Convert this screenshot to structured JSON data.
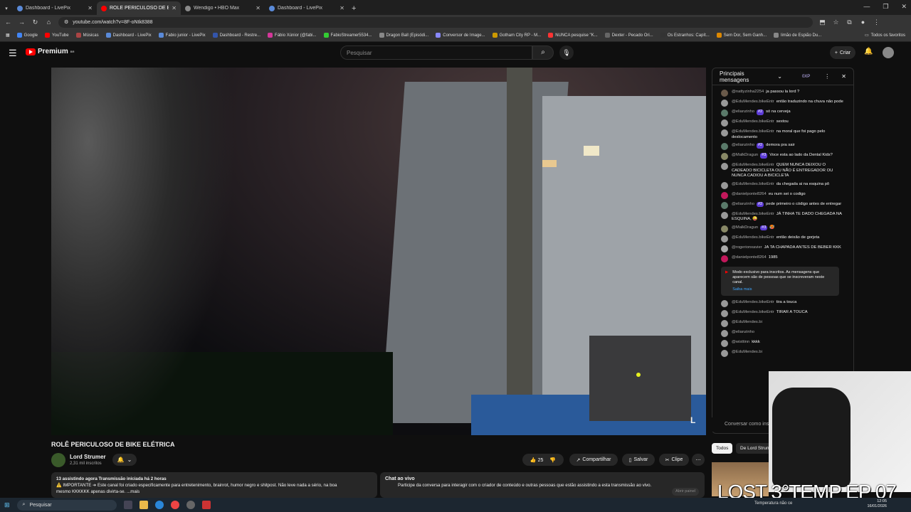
{
  "browser": {
    "tabs": [
      {
        "title": "Dashboard - LivePix",
        "active": false,
        "color": "#5a8ad8"
      },
      {
        "title": "ROLÊ PERICULOSO DE BIKE",
        "active": true,
        "color": "#ff0000"
      },
      {
        "title": "Wendigo • HBO Max",
        "active": false,
        "color": "#8a8a8a"
      },
      {
        "title": "Dashboard - LivePix",
        "active": false,
        "color": "#5a8ad8"
      }
    ],
    "url": "youtube.com/watch?v=8F-oNtk8388",
    "bookmarks": [
      "Google",
      "YouTube",
      "Músicas",
      "Dashboard - LivePix",
      "Fabio junior - LivePix",
      "Dashboard - Restre...",
      "Fábio Xúnior (@fabi...",
      "FabioStreamer5534...",
      "Dragon Ball (Episódi...",
      "Conversor de Image...",
      "Gotham City RP - M...",
      "NUNCA pesquise \"K...",
      "Dexter - Pecado Ori...",
      "Os Estranhos: Capít...",
      "Sem Dor, Sem Ganh...",
      "limão de Espião Du..."
    ],
    "bookmarks_all": "Todos os favoritos"
  },
  "youtube": {
    "logo_text": "Premium",
    "logo_sup": "BR",
    "search_placeholder": "Pesquisar",
    "create_label": "Criar"
  },
  "video": {
    "title": "ROLÊ PERICULOSO DE BIKE ELÉTRICA",
    "channel": "Lord Strumer",
    "subs": "2,31 mil inscritos",
    "likes": "25",
    "share": "Compartilhar",
    "save": "Salvar",
    "clip": "Clipe",
    "watermark": "L",
    "desc_line1": "13 assistindo agora  Transmissão iniciada há 2 horas",
    "desc_line2": "⚠️ IMPORTANTE ➔ Este canal foi criado especificamente para entretenimento, brainrot, humor negro e shitpost. Não leve nada a sério, na boa",
    "desc_line3": "mesmo KKKKKK apenas divirta-se.   ...mais",
    "chat_title": "Chat ao vivo",
    "chat_desc": "Participe da conversa para interagir com o criador de conteúdo e outras pessoas que estão assistindo a esta transmissão ao vivo.",
    "chat_open": "Abrir painel"
  },
  "chat": {
    "header": "Principais mensagens",
    "xp": "0XP",
    "input_placeholder": "Conversar como ins",
    "messages": [
      {
        "author": "@nattyzinha2254",
        "badge": "",
        "text": "ja passou la lord ?"
      },
      {
        "author": "@EduMendes.bikeEntr",
        "badge": "",
        "text": "então traduzindo na chuva não pode"
      },
      {
        "author": "@elianzinho",
        "badge": "#2",
        "text": "só na cerveja"
      },
      {
        "author": "@EduMendes.bikeEntr",
        "badge": "",
        "text": "sextou"
      },
      {
        "author": "@EduMendes.bikeEntr",
        "badge": "",
        "text": "na moral que foi pago pelo deslocamento"
      },
      {
        "author": "@elianzinho",
        "badge": "#2",
        "text": "demora pra sair"
      },
      {
        "author": "@MalkDragun",
        "badge": "#3",
        "text": "Voce esta ao lado da Dental Kids?"
      },
      {
        "author": "@EduMendes.bikeEntr",
        "badge": "",
        "text": "QUEM NUNCA DEIXOU O CADEADO BICICLETA OU NÃO É ENTREGADOR OU NUNCA CADIOU A BICICLETA"
      },
      {
        "author": "@EduMendes.bikeEntr",
        "badge": "",
        "text": "da chegada ai na esquina pô"
      },
      {
        "author": "@danielponte8264",
        "badge": "",
        "text": "eu num sei o codigo"
      },
      {
        "author": "@elianzinho",
        "badge": "#2",
        "text": "pede primeiro o código antes de entregar"
      },
      {
        "author": "@EduMendes.bikeEntr",
        "badge": "",
        "text": "JÁ TINHA TE DADO CHEGADA NA ESQUINA, 😜"
      },
      {
        "author": "@MalkDragun",
        "badge": "#3",
        "text": "🥵"
      },
      {
        "author": "@EduMendes.bikeEntr",
        "badge": "",
        "text": "então deixão de gorjeta"
      },
      {
        "author": "@rogerionxavier",
        "badge": "",
        "text": "JA TA CHAPADA ANTES DE BEBER KKK"
      },
      {
        "author": "@danielponte8264",
        "badge": "",
        "text": "1985"
      }
    ],
    "notice": "Modo exclusivo para inscritos. As mensagens que aparecem são de pessoas que se inscreveram neste canal.",
    "notice_link": "Saiba mais",
    "messages2": [
      {
        "author": "@EduMendes.bikeEntr",
        "badge": "",
        "text": "tira a touca"
      },
      {
        "author": "@EduMendes.bikeEntr",
        "badge": "",
        "text": "TIRAR A TOUCA"
      },
      {
        "author": "@EduMendes.bi",
        "badge": "",
        "text": ""
      },
      {
        "author": "@elianzinho",
        "badge": "",
        "text": ""
      },
      {
        "author": "@wisttinn",
        "badge": "",
        "text": "kkkk"
      },
      {
        "author": "@EduMendes.bi",
        "badge": "",
        "text": ""
      }
    ]
  },
  "chips": {
    "all": "Todos",
    "from": "De Lord Strun"
  },
  "overlay_text": "LOST 3°TEMP EP 07",
  "taskbar": {
    "search": "Pesquisar",
    "weather": "Temperatura não ce",
    "lang": "POR\nPTB",
    "time": "12:05",
    "date": "16/01/2026"
  }
}
